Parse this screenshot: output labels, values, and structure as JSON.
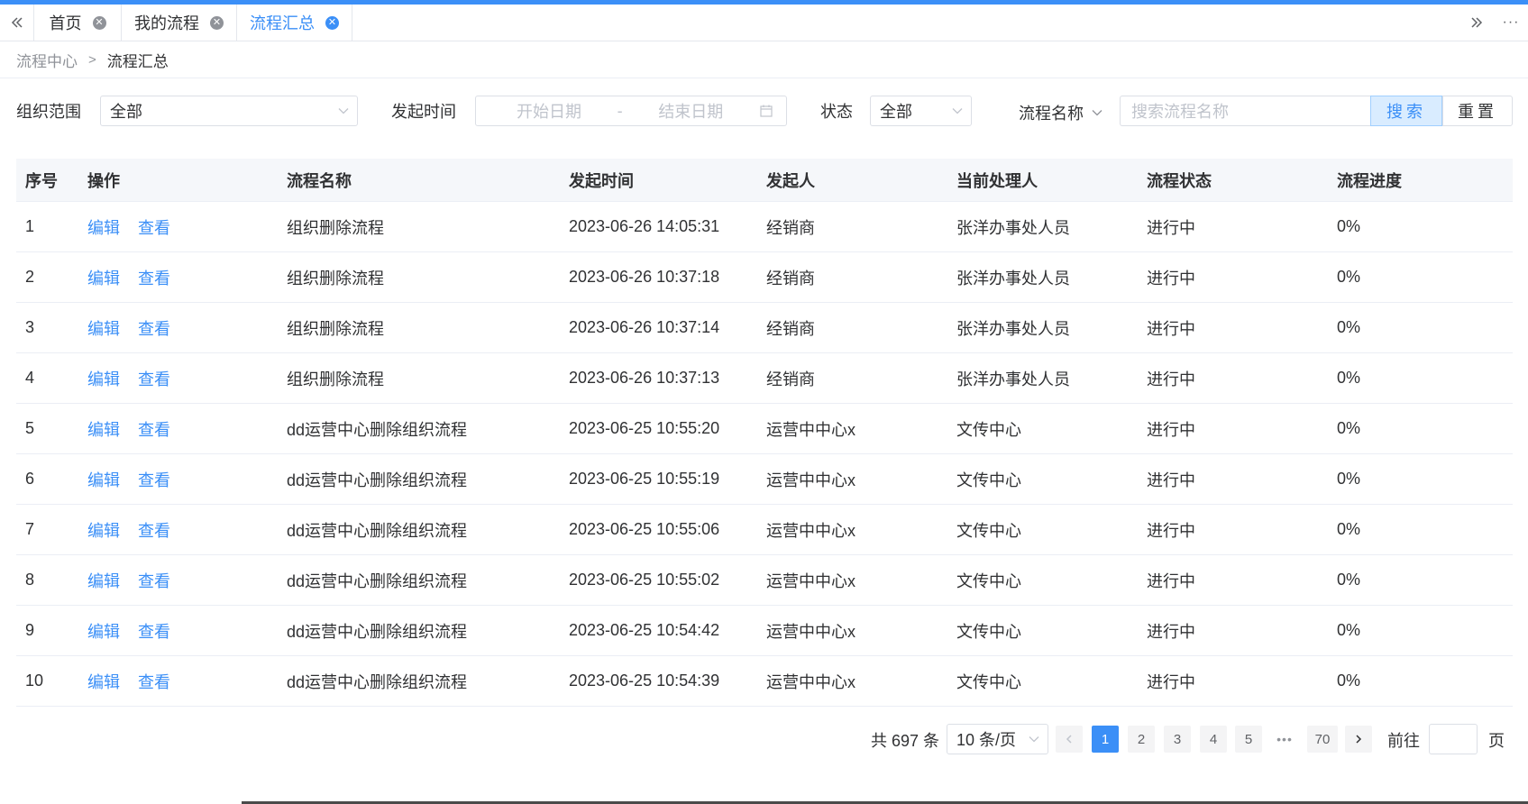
{
  "tabs": {
    "items": [
      {
        "label": "首页"
      },
      {
        "label": "我的流程"
      },
      {
        "label": "流程汇总"
      }
    ],
    "active_index": 2
  },
  "breadcrumb": [
    "流程中心",
    "流程汇总"
  ],
  "filters": {
    "org_scope": {
      "label": "组织范围",
      "value": "全部"
    },
    "start_time": {
      "label": "发起时间",
      "start_placeholder": "开始日期",
      "sep": "-",
      "end_placeholder": "结束日期"
    },
    "status": {
      "label": "状态",
      "value": "全部"
    },
    "name": {
      "label": "流程名称",
      "placeholder": "搜索流程名称"
    },
    "search_label": "搜索",
    "reset_label": "重置"
  },
  "table": {
    "headers": [
      "序号",
      "操作",
      "流程名称",
      "发起时间",
      "发起人",
      "当前处理人",
      "流程状态",
      "流程进度"
    ],
    "actions": [
      "编辑",
      "查看"
    ],
    "rows": [
      {
        "no": "1",
        "name": "组织删除流程",
        "time": "2023-06-26 14:05:31",
        "initiator": "经销商",
        "handler": "张洋办事处人员",
        "status": "进行中",
        "progress": "0%"
      },
      {
        "no": "2",
        "name": "组织删除流程",
        "time": "2023-06-26 10:37:18",
        "initiator": "经销商",
        "handler": "张洋办事处人员",
        "status": "进行中",
        "progress": "0%"
      },
      {
        "no": "3",
        "name": "组织删除流程",
        "time": "2023-06-26 10:37:14",
        "initiator": "经销商",
        "handler": "张洋办事处人员",
        "status": "进行中",
        "progress": "0%"
      },
      {
        "no": "4",
        "name": "组织删除流程",
        "time": "2023-06-26 10:37:13",
        "initiator": "经销商",
        "handler": "张洋办事处人员",
        "status": "进行中",
        "progress": "0%"
      },
      {
        "no": "5",
        "name": "dd运营中心删除组织流程",
        "time": "2023-06-25 10:55:20",
        "initiator": "运营中中心x",
        "handler": "文传中心",
        "status": "进行中",
        "progress": "0%"
      },
      {
        "no": "6",
        "name": "dd运营中心删除组织流程",
        "time": "2023-06-25 10:55:19",
        "initiator": "运营中中心x",
        "handler": "文传中心",
        "status": "进行中",
        "progress": "0%"
      },
      {
        "no": "7",
        "name": "dd运营中心删除组织流程",
        "time": "2023-06-25 10:55:06",
        "initiator": "运营中中心x",
        "handler": "文传中心",
        "status": "进行中",
        "progress": "0%"
      },
      {
        "no": "8",
        "name": "dd运营中心删除组织流程",
        "time": "2023-06-25 10:55:02",
        "initiator": "运营中中心x",
        "handler": "文传中心",
        "status": "进行中",
        "progress": "0%"
      },
      {
        "no": "9",
        "name": "dd运营中心删除组织流程",
        "time": "2023-06-25 10:54:42",
        "initiator": "运营中中心x",
        "handler": "文传中心",
        "status": "进行中",
        "progress": "0%"
      },
      {
        "no": "10",
        "name": "dd运营中心删除组织流程",
        "time": "2023-06-25 10:54:39",
        "initiator": "运营中中心x",
        "handler": "文传中心",
        "status": "进行中",
        "progress": "0%"
      }
    ]
  },
  "pagination": {
    "total_text": "共 697 条",
    "page_size": "10 条/页",
    "pages": [
      "1",
      "2",
      "3",
      "4",
      "5"
    ],
    "last_page": "70",
    "current_page": "1",
    "goto_label": "前往",
    "page_suffix": "页"
  },
  "colors": {
    "accent": "#3b8ff7",
    "header_bg": "#f5f7fa"
  }
}
